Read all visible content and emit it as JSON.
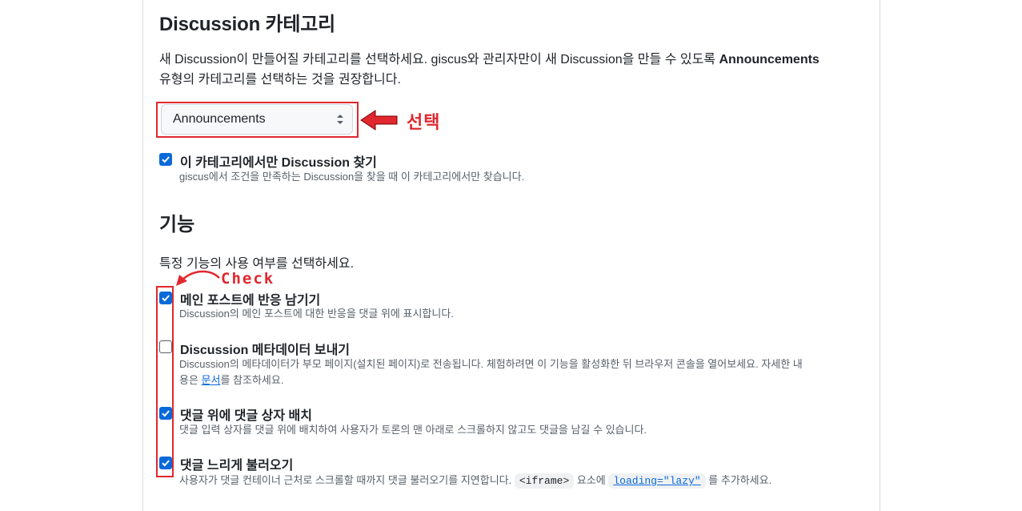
{
  "category": {
    "heading": "Discussion 카테고리",
    "desc_part1": "새 Discussion이 만들어질 카테고리를 선택하세요. giscus와 관리자만이 새 Discussion을 만들 수 있도록 ",
    "desc_bold": "Announcements",
    "desc_part2": "유형의 카테고리를 선택하는 것을 권장합니다.",
    "selected_value": "Announcements",
    "filter_title": "이 카테고리에서만 Discussion 찾기",
    "filter_desc": "giscus에서 조건을 만족하는 Discussion을 찾을 때 이 카테고리에서만 찾습니다.",
    "filter_checked": true
  },
  "features": {
    "heading": "기능",
    "desc": "특정 기능의 사용 여부를 선택하세요.",
    "items": [
      {
        "title": "메인 포스트에 반응 남기기",
        "desc": "Discussion의 메인 포스트에 대한 반응을 댓글 위에 표시합니다.",
        "checked": true
      },
      {
        "title": "Discussion 메타데이터 보내기",
        "desc_line1": "Discussion의 메타데이터가 부모 페이지(설치된 페이지)로 전송됩니다. 체험하려면 이 기능을 활성화한 뒤 브라우저 콘솔을 열어보세요. 자세한 내",
        "desc_line2_pre": "용은 ",
        "desc_link": "문서",
        "desc_line2_post": "를 참조하세요.",
        "checked": false
      },
      {
        "title": "댓글 위에 댓글 상자 배치",
        "desc": "댓글 입력 상자를 댓글 위에 배치하여 사용자가 토론의 맨 아래로 스크롤하지 않고도 댓글을 남길 수 있습니다.",
        "checked": true
      },
      {
        "title": "댓글 느리게 불러오기",
        "desc_pre": "사용자가 댓글 컨테이너 근처로 스크롤할 때까지 댓글 불러오기를 지연합니다. ",
        "desc_code1": "<iframe>",
        "desc_mid": " 요소에 ",
        "desc_code2": "loading=\"lazy\"",
        "desc_post": " 를 추가하세요.",
        "checked": true
      }
    ]
  },
  "annotations": {
    "select_label": "선택",
    "check_label": "Check",
    "color": "#e0282e"
  },
  "colors": {
    "accent": "#0969da",
    "muted_text": "#57606a",
    "border": "#d0d7de"
  }
}
